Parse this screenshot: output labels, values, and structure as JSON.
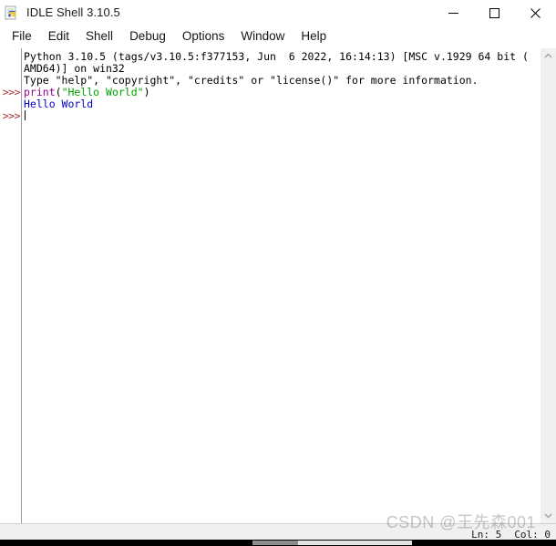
{
  "window": {
    "title": "IDLE Shell 3.10.5",
    "icon": "python-idle-icon",
    "controls": {
      "minimize": "minimize-icon",
      "maximize": "maximize-icon",
      "close": "close-icon"
    }
  },
  "menubar": {
    "items": [
      {
        "label": "File"
      },
      {
        "label": "Edit"
      },
      {
        "label": "Shell"
      },
      {
        "label": "Debug"
      },
      {
        "label": "Options"
      },
      {
        "label": "Window"
      },
      {
        "label": "Help"
      }
    ]
  },
  "shell": {
    "prompts": [
      {
        "line": 0,
        "text": ""
      },
      {
        "line": 1,
        "text": ""
      },
      {
        "line": 2,
        "text": ""
      },
      {
        "line": 3,
        "text": ">>>"
      },
      {
        "line": 4,
        "text": ""
      },
      {
        "line": 5,
        "text": ">>>"
      }
    ],
    "lines": [
      {
        "id": "banner-line-1",
        "segments": [
          {
            "style": "plain",
            "text": "Python 3.10.5 (tags/v3.10.5:f377153, Jun  6 2022, 16:14:13) [MSC v.1929 64 bit ("
          }
        ]
      },
      {
        "id": "banner-line-2",
        "segments": [
          {
            "style": "plain",
            "text": "AMD64)] on win32"
          }
        ]
      },
      {
        "id": "banner-line-3",
        "segments": [
          {
            "style": "plain",
            "text": "Type \"help\", \"copyright\", \"credits\" or \"license()\" for more information."
          }
        ]
      },
      {
        "id": "input-line-1",
        "segments": [
          {
            "style": "keyword",
            "text": "print"
          },
          {
            "style": "plain",
            "text": "("
          },
          {
            "style": "string",
            "text": "\"Hello World\""
          },
          {
            "style": "plain",
            "text": ")"
          }
        ]
      },
      {
        "id": "output-line-1",
        "segments": [
          {
            "style": "output",
            "text": "Hello World"
          }
        ]
      },
      {
        "id": "current-input-line",
        "segments": []
      }
    ],
    "colors": {
      "keyword": "#900090",
      "string": "#00a000",
      "output": "#0000c8",
      "plain": "#000000",
      "prompt": "#b03030",
      "background": "#ffffff"
    }
  },
  "scrollbar": {
    "up_arrow": "chevron-up-icon",
    "down_arrow": "chevron-down-icon"
  },
  "statusbar": {
    "line_label": "Ln: 5",
    "col_label": "Col: 0"
  },
  "watermark": {
    "text": "CSDN @王先森001"
  }
}
